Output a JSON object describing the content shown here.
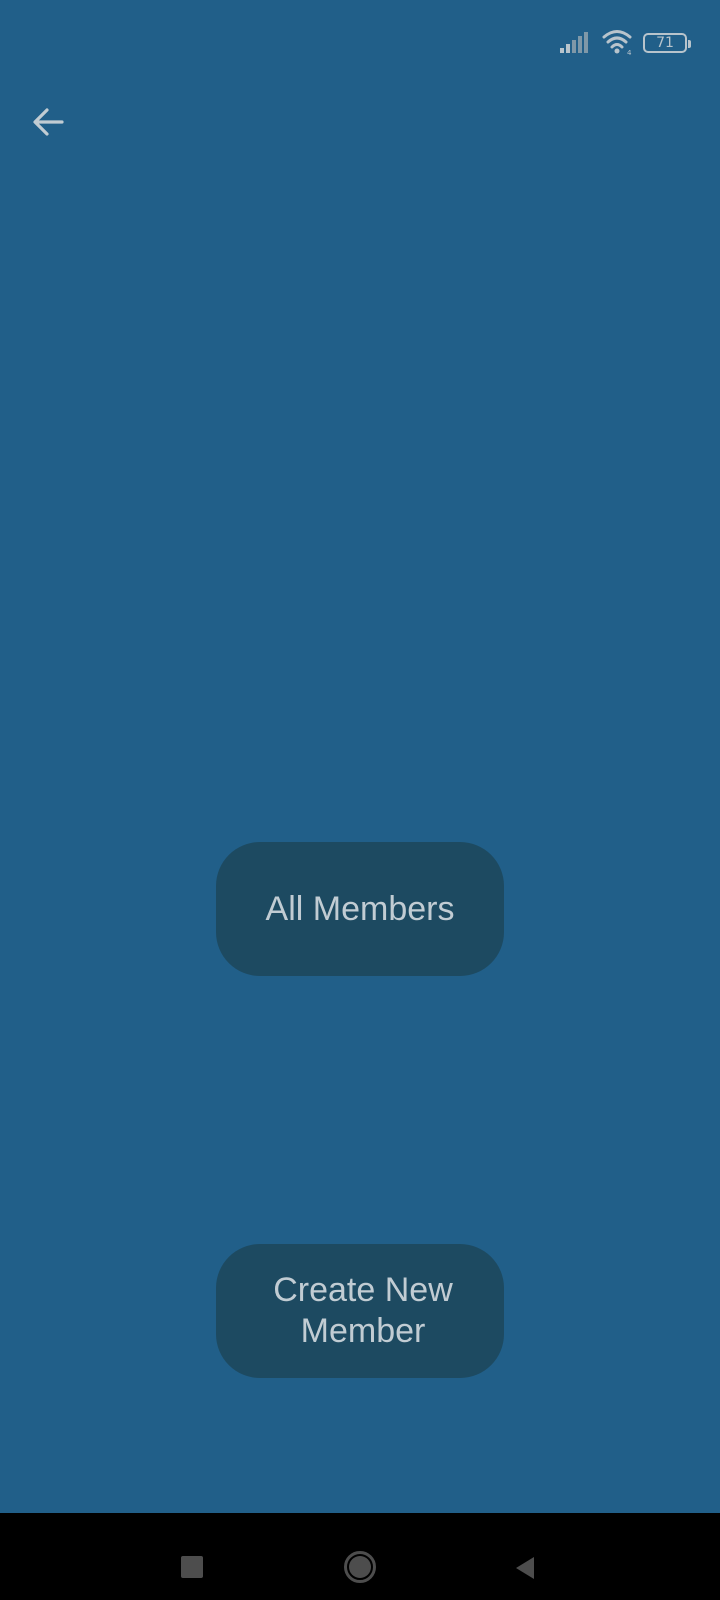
{
  "status_bar": {
    "battery_level": "71",
    "icons": [
      "signal-icon",
      "wifi-icon",
      "battery-icon"
    ]
  },
  "app_bar": {
    "back_icon": "arrow-left-icon"
  },
  "buttons": {
    "all_members": "All Members",
    "create_new_member": "Create New Member"
  },
  "nav_bar": {
    "icons": [
      "recents-icon",
      "home-icon",
      "back-triangle-icon"
    ]
  },
  "colors": {
    "background": "#215f89",
    "button": "#1d4a61",
    "button_text": "#c1ccd3",
    "nav_bar": "#000000"
  }
}
